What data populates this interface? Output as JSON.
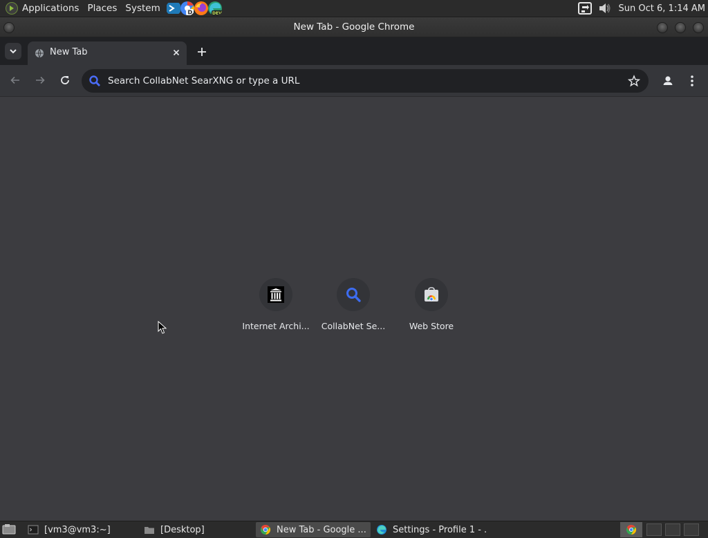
{
  "top_panel": {
    "menus": [
      "Applications",
      "Places",
      "System"
    ],
    "launchers": [
      "vscode-icon",
      "chrome-dev-icon",
      "firefox-icon",
      "edge-dev-icon"
    ],
    "clock": "Sun Oct  6,  1:14 AM"
  },
  "window": {
    "title": "New Tab - Google Chrome"
  },
  "browser": {
    "tab_title": "New Tab",
    "omnibox_placeholder": "Search CollabNet SearXNG or type a URL",
    "shortcuts": [
      {
        "label": "Internet Archi...",
        "icon": "archive-icon"
      },
      {
        "label": "CollabNet Se...",
        "icon": "search-icon"
      },
      {
        "label": "Web Store",
        "icon": "web-store-icon"
      }
    ]
  },
  "taskbar": {
    "tasks": [
      {
        "label": "[vm3@vm3:~]",
        "icon": "terminal-icon",
        "active": false
      },
      {
        "label": "[Desktop]",
        "icon": "folder-icon",
        "active": false
      },
      {
        "label": "New Tab - Google ...",
        "icon": "chrome-icon",
        "active": true
      },
      {
        "label": "Settings - Profile 1 - ...",
        "icon": "edge-icon",
        "active": false
      }
    ]
  },
  "colors": {
    "panel_bg": "#2b2b2b",
    "tabstrip_bg": "#202124",
    "toolbar_bg": "#35363a",
    "content_bg": "#3c3c40",
    "accent_blue": "#8ab4f8"
  }
}
